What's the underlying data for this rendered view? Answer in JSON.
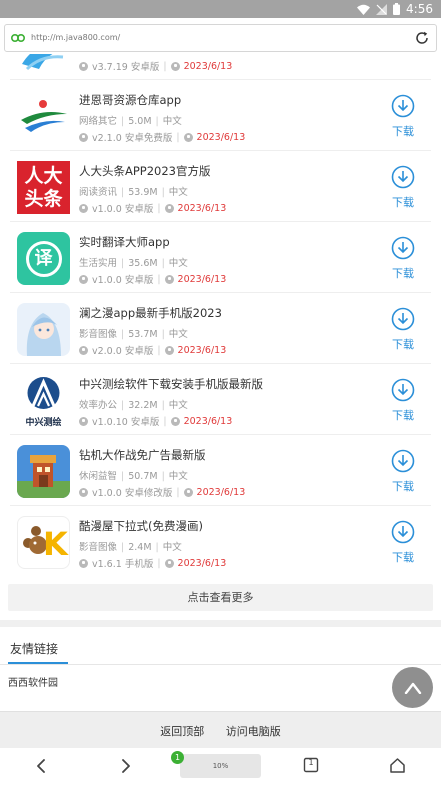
{
  "status_bar": {
    "time": "4:56"
  },
  "url_bar": {
    "url": "http://m.java800.com/"
  },
  "apps": [
    {
      "name": "",
      "category": "",
      "size": "",
      "lang": "",
      "version": "v3.7.19 安卓版",
      "date": "2023/6/13",
      "download_label": "下载",
      "icon": "blue-wave-icon"
    },
    {
      "name": "进恩哥资源仓库app",
      "category": "网络其它",
      "size": "5.0M",
      "lang": "中文",
      "version": "v2.1.0 安卓免费版",
      "date": "2023/6/13",
      "download_label": "下载",
      "icon": "colorful-swoosh-icon"
    },
    {
      "name": "人大头条APP2023官方版",
      "category": "阅读资讯",
      "size": "53.9M",
      "lang": "中文",
      "version": "v1.0.0 安卓版",
      "date": "2023/6/13",
      "download_label": "下载",
      "icon": "renda-toutiao-icon",
      "icon_text": "人大头条"
    },
    {
      "name": "实时翻译大师app",
      "category": "生活实用",
      "size": "35.6M",
      "lang": "中文",
      "version": "v1.0.0 安卓版",
      "date": "2023/6/13",
      "download_label": "下载",
      "icon": "translate-icon",
      "icon_text": "译"
    },
    {
      "name": "澜之漫app最新手机版2023",
      "category": "影音图像",
      "size": "53.7M",
      "lang": "中文",
      "version": "v2.0.0 安卓版",
      "date": "2023/6/13",
      "download_label": "下载",
      "icon": "anime-girl-icon"
    },
    {
      "name": "中兴测绘软件下载安装手机版最新版",
      "category": "效率办公",
      "size": "32.2M",
      "lang": "中文",
      "version": "v1.0.10 安卓版",
      "date": "2023/6/13",
      "download_label": "下载",
      "icon": "zhongxing-cehui-icon",
      "icon_text": "中兴测绘"
    },
    {
      "name": "钻机大作战免广告最新版",
      "category": "休闲益智",
      "size": "50.7M",
      "lang": "中文",
      "version": "v1.0.0 安卓修改版",
      "date": "2023/6/13",
      "download_label": "下载",
      "icon": "drill-tower-icon"
    },
    {
      "name": "酷漫屋下拉式(免费漫画)",
      "category": "影音图像",
      "size": "2.4M",
      "lang": "中文",
      "version": "v1.6.1 手机版",
      "date": "2023/6/13",
      "download_label": "下载",
      "icon": "kumanwu-icon",
      "icon_text": "K"
    }
  ],
  "more_button": "点击查看更多",
  "friend_links": {
    "title": "友情链接",
    "items": [
      "西西软件园"
    ]
  },
  "footer": {
    "back_top": "返回顶部",
    "desktop": "访问电脑版"
  },
  "bottom_nav": {
    "badge": "1",
    "progress": "10%",
    "tabs_count": "1"
  },
  "colors": {
    "accent": "#2b8fd8",
    "date": "#e03a3a",
    "badge": "#3cb034"
  }
}
